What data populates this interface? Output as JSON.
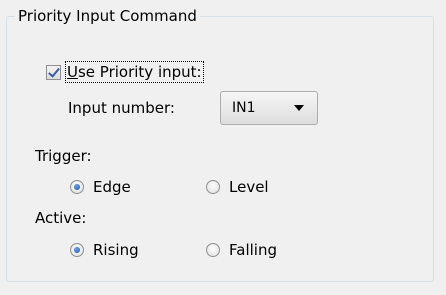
{
  "group": {
    "title": "Priority Input Command"
  },
  "use_priority": {
    "label": "Use Priority input:",
    "checked": true
  },
  "input_number": {
    "label": "Input number:",
    "value": "IN1"
  },
  "trigger": {
    "label": "Trigger:",
    "options": [
      {
        "label": "Edge",
        "selected": true
      },
      {
        "label": "Level",
        "selected": false
      }
    ]
  },
  "active": {
    "label": "Active:",
    "options": [
      {
        "label": "Rising",
        "selected": true
      },
      {
        "label": "Falling",
        "selected": false
      }
    ]
  }
}
